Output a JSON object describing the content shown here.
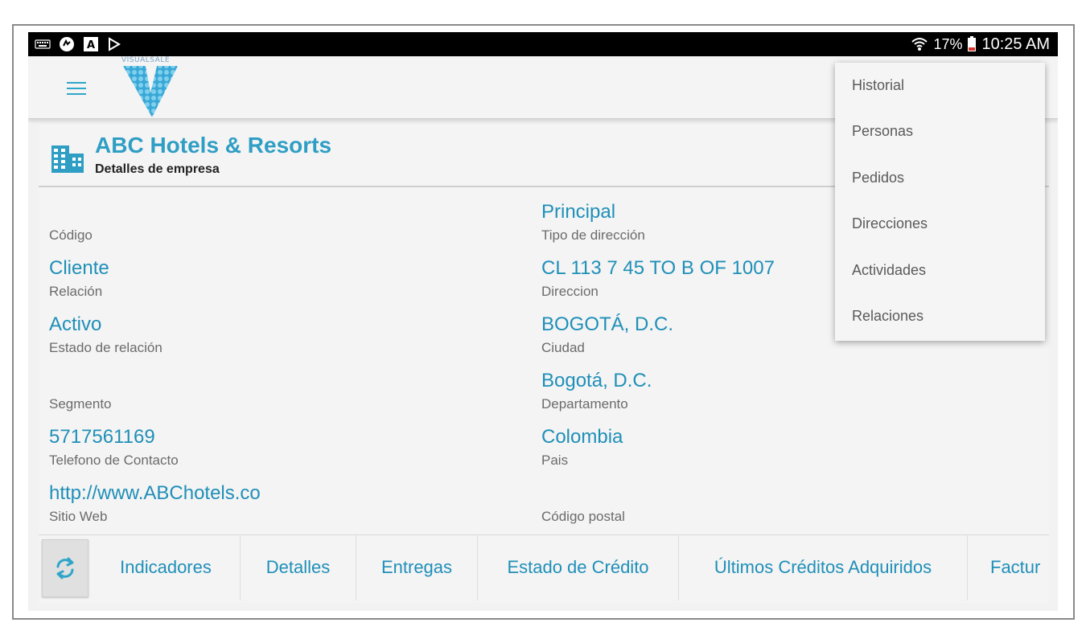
{
  "status_bar": {
    "battery": "17%",
    "time": "10:25 AM",
    "left_icons": [
      "keyboard-icon",
      "sync-icon",
      "font-icon",
      "play-store-icon"
    ],
    "right_icons": [
      "wifi-icon",
      "battery-icon"
    ]
  },
  "app_bar": {
    "logo_text": "VISUALSALE"
  },
  "company": {
    "name": "ABC Hotels & Resorts",
    "subtitle": "Detalles de empresa"
  },
  "left_fields": [
    {
      "value": "",
      "label": "Código"
    },
    {
      "value": "Cliente",
      "label": "Relación"
    },
    {
      "value": "Activo",
      "label": "Estado de relación"
    },
    {
      "value": "",
      "label": "Segmento"
    },
    {
      "value": "5717561169",
      "label": "Telefono de Contacto"
    },
    {
      "value": "http://www.ABChotels.co",
      "label": "Sitio Web"
    }
  ],
  "right_fields": [
    {
      "value": "Principal",
      "label": "Tipo de dirección"
    },
    {
      "value": "CL 113 7 45 TO B OF 1007",
      "label": "Direccion"
    },
    {
      "value": "BOGOTÁ, D.C.",
      "label": "Ciudad"
    },
    {
      "value": "Bogotá, D.C.",
      "label": "Departamento"
    },
    {
      "value": "Colombia",
      "label": "Pais"
    },
    {
      "value": "",
      "label": "Código postal"
    }
  ],
  "tabs": [
    "Indicadores",
    "Detalles",
    "Entregas",
    "Estado de Crédito",
    "Últimos Créditos Adquiridos",
    "Factur"
  ],
  "popup_menu": [
    "Historial",
    "Personas",
    "Pedidos",
    "Direcciones",
    "Actividades",
    "Relaciones"
  ],
  "colors": {
    "accent": "#1f8fb8",
    "title": "#2f9ec4",
    "status_bar": "#000000"
  }
}
